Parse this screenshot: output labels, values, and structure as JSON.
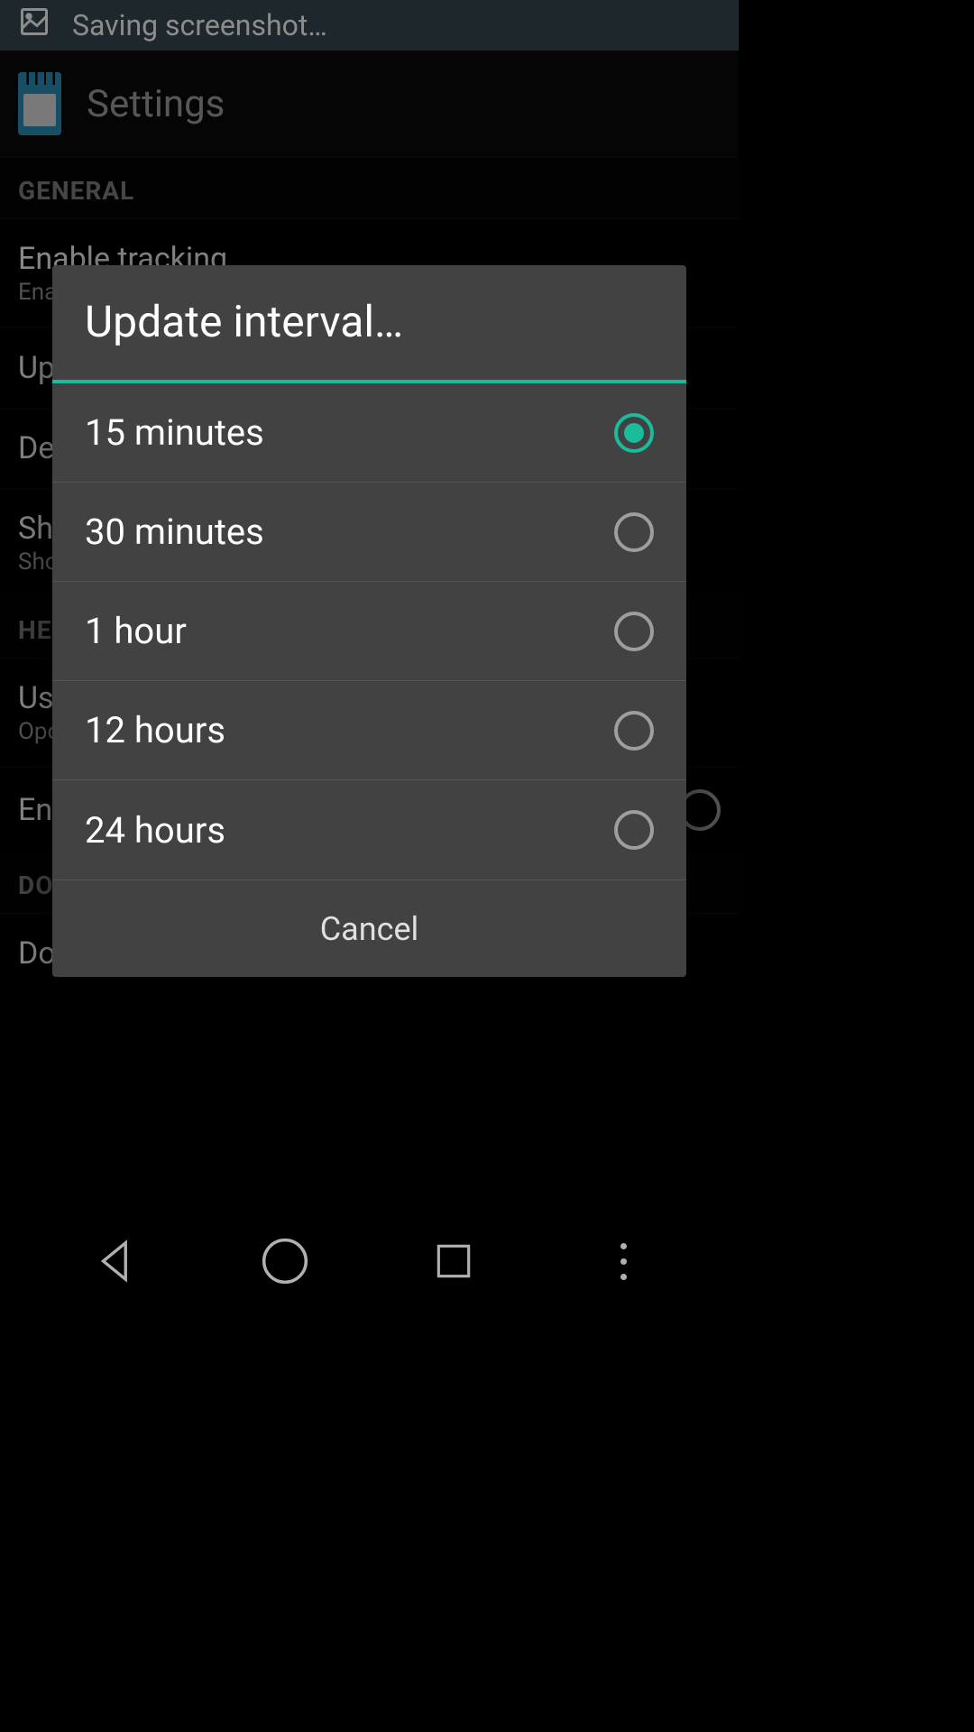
{
  "status_bar": {
    "text": "Saving screenshot…"
  },
  "app_bar": {
    "title": "Settings"
  },
  "sections": {
    "general": {
      "header": "GENERAL",
      "items": [
        {
          "title": "Enable tracking",
          "sub": "Ena"
        },
        {
          "title": "Up"
        },
        {
          "title": "De"
        },
        {
          "title": "Sh",
          "sub": "Sho"
        }
      ]
    },
    "help": {
      "header": "HE",
      "items": [
        {
          "title": "Us",
          "sub": "Opo"
        },
        {
          "title": "Enable logging"
        }
      ]
    },
    "donate": {
      "header": "DONATE",
      "items": [
        {
          "title": "Donate Bitcoins"
        }
      ]
    }
  },
  "dialog": {
    "title": "Update interval…",
    "options": [
      {
        "label": "15 minutes",
        "selected": true
      },
      {
        "label": "30 minutes",
        "selected": false
      },
      {
        "label": "1 hour",
        "selected": false
      },
      {
        "label": "12 hours",
        "selected": false
      },
      {
        "label": "24 hours",
        "selected": false
      }
    ],
    "cancel": "Cancel"
  }
}
